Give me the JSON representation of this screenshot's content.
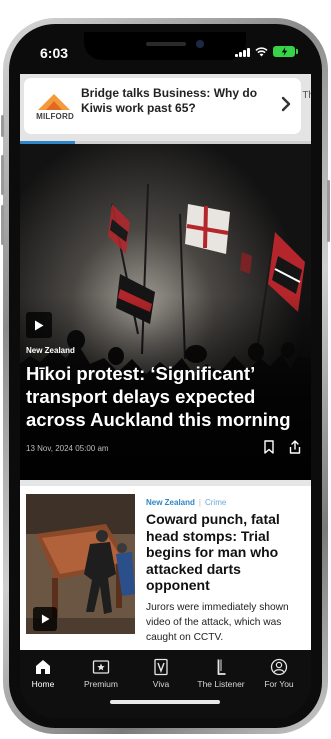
{
  "status_bar": {
    "time": "6:03"
  },
  "ad": {
    "brand": "MILFORD",
    "headline": "Bridge talks Business: Why do Kiwis work past 65?",
    "peek_text": "Th",
    "progress": 0.19
  },
  "hero": {
    "section": "New Zealand",
    "title": "Hīkoi protest: ‘Significant’ transport delays expected across Auckland this morning",
    "date": "13 Nov, 2024 05:00 am"
  },
  "story": {
    "section": "New Zealand",
    "divider": "|",
    "subsection": "Crime",
    "title": "Coward punch, fatal head stomps: Trial begins for man who attacked darts opponent",
    "summary": "Jurors were immediately shown video of the attack, which was caught on CCTV."
  },
  "tabs": [
    {
      "label": "Home",
      "icon": "home-icon",
      "active": true
    },
    {
      "label": "Premium",
      "icon": "premium-star-icon",
      "active": false
    },
    {
      "label": "Viva",
      "icon": "viva-icon",
      "active": false
    },
    {
      "label": "The Listener",
      "icon": "listener-icon",
      "active": false
    },
    {
      "label": "For You",
      "icon": "profile-icon",
      "active": false
    }
  ],
  "colors": {
    "accent": "#2f86c8",
    "tab_bar_bg": "#0f0f0f",
    "battery": "#37d44a"
  }
}
